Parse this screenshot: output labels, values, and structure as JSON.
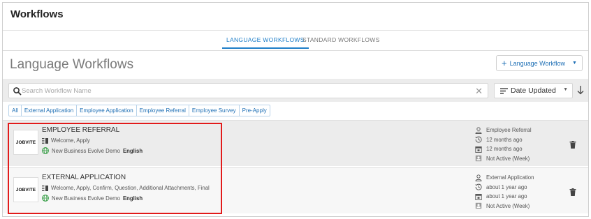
{
  "app": {
    "title": "Workflows"
  },
  "tabs": [
    {
      "label": "LANGUAGE WORKFLOWS",
      "active": true
    },
    {
      "label": "STANDARD WORKFLOWS",
      "active": false
    }
  ],
  "header": {
    "title": "Language Workflows",
    "add_button_label": "Language Workflow"
  },
  "search": {
    "placeholder": "Search Workflow Name",
    "value": ""
  },
  "sort": {
    "label": "Date Updated"
  },
  "filters": [
    "All",
    "External Application",
    "Employee Application",
    "Employee Referral",
    "Employee Survey",
    "Pre-Apply"
  ],
  "workflows": [
    {
      "logo": "JOBVITE",
      "name": "EMPLOYEE REFERRAL",
      "steps": "Welcome, Apply",
      "company": "New Business Evolve Demo",
      "language": "English",
      "type": "Employee Referral",
      "created": "12 months ago",
      "updated": "12 months ago",
      "status": "Not Active (Week)"
    },
    {
      "logo": "JOBVITE",
      "name": "EXTERNAL APPLICATION",
      "steps": "Welcome, Apply, Confirm, Question, Additional Attachments, Final",
      "company": "New Business Evolve Demo",
      "language": "English",
      "type": "External Application",
      "created": "about 1 year ago",
      "updated": "about 1 year ago",
      "status": "Not Active (Week)"
    }
  ],
  "colors": {
    "accent": "#1e7ec8",
    "highlight": "#e21b1b",
    "globe": "#2e9a3e"
  }
}
